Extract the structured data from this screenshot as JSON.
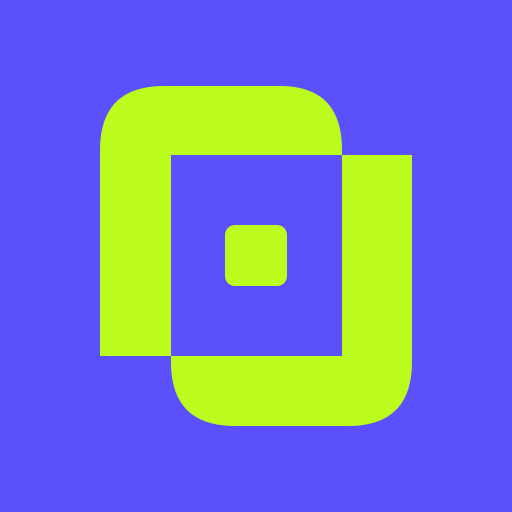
{
  "icon": {
    "name": "app-logo-icon",
    "colors": {
      "background": "#5b50fc",
      "accent": "#bbfb1d"
    }
  }
}
